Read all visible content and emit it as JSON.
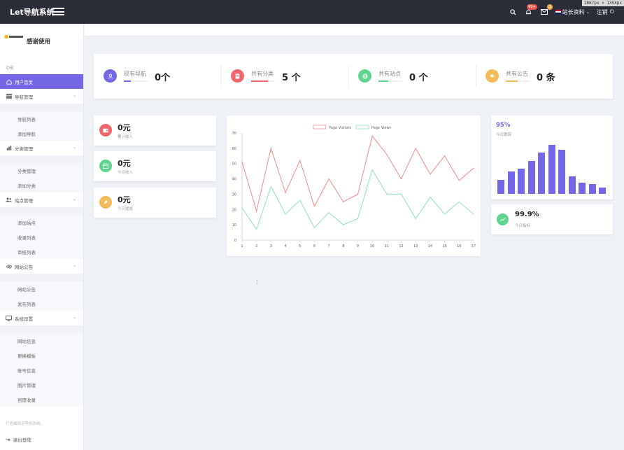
{
  "topbar": {
    "brand": "Let导航系统",
    "dim_tag": "1867px × 1354px",
    "notif_badge": "99+",
    "mail_badge": "1",
    "profile_label": "站长资料",
    "logout_label": "注销",
    "colors": {
      "bg": "#2b2d38",
      "notif_badge": "#e8564b",
      "mail_badge": "#f0ad4e"
    }
  },
  "sidebar": {
    "site_name": "感谢使用",
    "section_label": "功能",
    "active_color": "#7468e6",
    "items": [
      {
        "label": "用户首页",
        "icon": "home-icon",
        "active": true
      },
      {
        "label": "导航管理",
        "icon": "list-icon",
        "expandable": true,
        "sub": [
          "导航列表",
          "添加导航"
        ]
      },
      {
        "label": "分类管理",
        "icon": "chart-icon",
        "expandable": true,
        "sub": [
          "分类管理",
          "添加分类"
        ]
      },
      {
        "label": "站点管理",
        "icon": "users-icon",
        "expandable": true,
        "sub": [
          "添加站点",
          "收录列表",
          "审核列表"
        ]
      },
      {
        "label": "网站公告",
        "icon": "link-icon",
        "expandable": true,
        "sub": [
          "网站公告",
          "发布列表"
        ]
      },
      {
        "label": "系统设置",
        "icon": "monitor-icon",
        "expandable": true,
        "sub": [
          "网站信息",
          "更换模板",
          "账号信息",
          "图片管理",
          "百度收录"
        ]
      }
    ],
    "footer_note": "打造最稳定导航系统。",
    "logout_label": "退出登陆"
  },
  "stats": [
    {
      "label": "现有导航",
      "value": "0个",
      "icon": "user-icon",
      "color": "#7468e6",
      "progress": 0.3
    },
    {
      "label": "共有分类",
      "value": "5 个",
      "icon": "file-icon",
      "color": "#f2666f",
      "progress": 0.7
    },
    {
      "label": "共有站点",
      "value": "0 个",
      "icon": "globe-icon",
      "color": "#5fd48f",
      "progress": 0.4
    },
    {
      "label": "共有公告",
      "value": "0 条",
      "icon": "megaphone-icon",
      "color": "#f4bb5a",
      "progress": 0.5
    }
  ],
  "small_cards": [
    {
      "amount": "0元",
      "desc": "累计收入",
      "icon": "wallet-icon",
      "color": "#f2666f"
    },
    {
      "amount": "0元",
      "desc": "今日收入",
      "icon": "calendar-icon",
      "color": "#5fd48f"
    },
    {
      "amount": "0元",
      "desc": "今日提成",
      "icon": "rocket-icon",
      "color": "#f4bb5a"
    }
  ],
  "chart_data": {
    "type": "line",
    "x": [
      1,
      2,
      3,
      4,
      5,
      6,
      7,
      8,
      9,
      10,
      11,
      12,
      13,
      14,
      15,
      16,
      17
    ],
    "ylim": [
      0,
      70
    ],
    "yticks": [
      0,
      10,
      20,
      30,
      40,
      50,
      60,
      70
    ],
    "legend_position": "top",
    "grid": false,
    "series": [
      {
        "name": "Page Visitors",
        "color": "#f08c8c",
        "values": [
          51,
          19,
          60,
          31,
          52,
          22,
          40,
          25,
          30,
          68,
          56,
          40,
          60,
          43,
          55,
          39,
          47
        ]
      },
      {
        "name": "Page Views",
        "color": "#8ee2b8",
        "values": [
          21,
          7,
          35,
          17,
          26,
          8,
          18,
          10,
          14,
          46,
          30,
          30,
          14,
          28,
          17,
          25,
          17
        ]
      }
    ]
  },
  "bar_card": {
    "percent": "95%",
    "label": "今日跟踪",
    "bars": [
      9,
      14,
      16,
      21,
      26,
      31,
      28,
      11,
      7,
      6,
      4
    ]
  },
  "metric_card": {
    "value": "99.9%",
    "label": "今日指标",
    "icon": "trend-icon",
    "color": "#5fd48f"
  },
  "tiny_mark": "⋮"
}
